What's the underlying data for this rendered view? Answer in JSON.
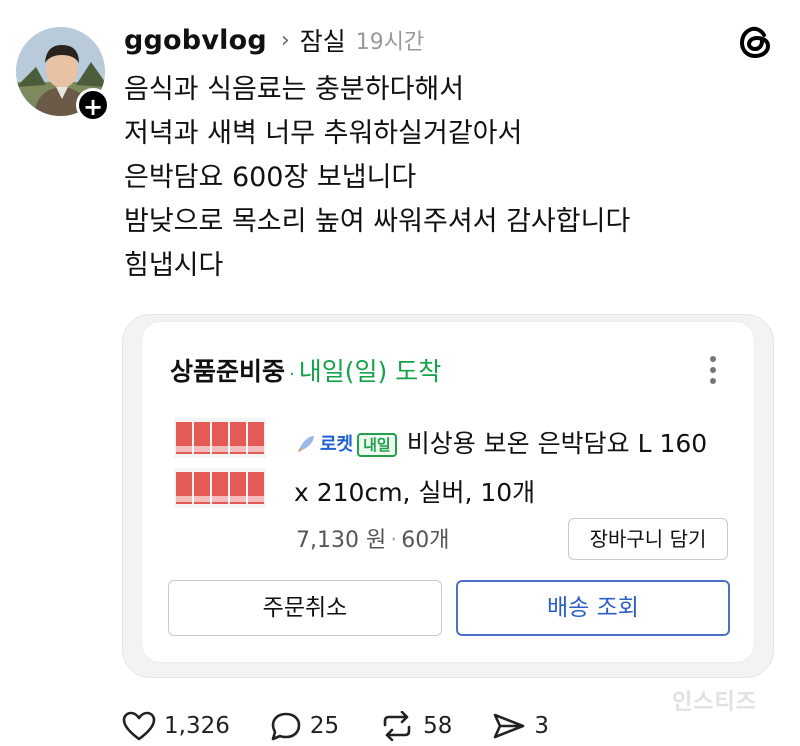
{
  "post": {
    "username": "ggobvlog",
    "topic": "잠실",
    "time": "19시간",
    "lines": [
      "음식과 식음료는 충분하다해서",
      "저녁과 새벽 너무 추워하실거같아서",
      "은박담요 600장 보냅니다",
      "밤낮으로 목소리 높여 싸워주셔서 감사합니다",
      "힘냅시다"
    ]
  },
  "order_card": {
    "status_main": "상품준비중",
    "status_dot": "·",
    "status_eta": "내일(일) 도착",
    "rocket_label": "로켓",
    "tomorrow_badge": "내일",
    "product_name_line1": "비상용 보온 은박담요 L 160",
    "product_name_line2": "x 210cm, 실버, 10개",
    "price": "7,130 원",
    "price_sep": "·",
    "quantity": "60개",
    "cart_button": "장바구니 담기",
    "cancel_button": "주문취소",
    "track_button": "배송 조회"
  },
  "actions": {
    "likes": "1,326",
    "comments": "25",
    "reposts": "58",
    "shares": "3"
  },
  "watermark": "인스티즈",
  "icons": {
    "threads_logo": "threads-logo-icon",
    "follow_plus": "plus-icon",
    "chevron": "chevron-right-icon",
    "more": "more-vertical-icon",
    "like": "heart-icon",
    "comment": "comment-icon",
    "repost": "repost-icon",
    "share": "send-icon"
  },
  "colors": {
    "eta_green": "#15a34a",
    "rocket_blue": "#1d5fd6",
    "track_blue": "#2c5fc8"
  }
}
